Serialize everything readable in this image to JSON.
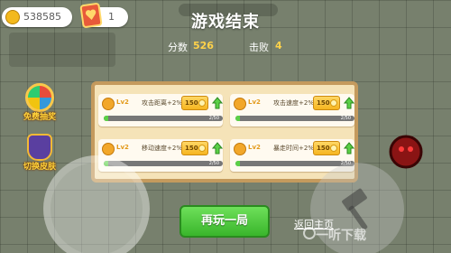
{
  "hud": {
    "coins": "538585",
    "cards": "1"
  },
  "side": {
    "lottery_label": "免费抽奖",
    "skin_label": "切换皮肤"
  },
  "result": {
    "title": "游戏结束",
    "score_label": "分数",
    "score": "526",
    "kills_label": "击败",
    "kills": "4"
  },
  "upgrades": [
    {
      "icon": "attack-range-icon",
      "level": "Lv2",
      "name": "攻击距离+2%",
      "cost": "150",
      "progress": "2/50",
      "progress_fraction": 0.04
    },
    {
      "icon": "attack-speed-icon",
      "level": "Lv2",
      "name": "攻击速度+2%",
      "cost": "150",
      "progress": "2/50",
      "progress_fraction": 0.04
    },
    {
      "icon": "move-speed-icon",
      "level": "Lv2",
      "name": "移动速度+2%",
      "cost": "150",
      "progress": "2/50",
      "progress_fraction": 0.04
    },
    {
      "icon": "rampage-time-icon",
      "level": "Lv2",
      "name": "暴走时间+2%",
      "cost": "150",
      "progress": "2/50",
      "progress_fraction": 0.04
    }
  ],
  "buttons": {
    "play_again": "再玩一局",
    "home": "返回主页"
  },
  "watermark": {
    "text": "一听下载"
  },
  "colors": {
    "accent_gold": "#ffd24a",
    "button_green": "#39b52b",
    "panel_bg": "#f5e3b8",
    "panel_border": "#c49a5d"
  }
}
